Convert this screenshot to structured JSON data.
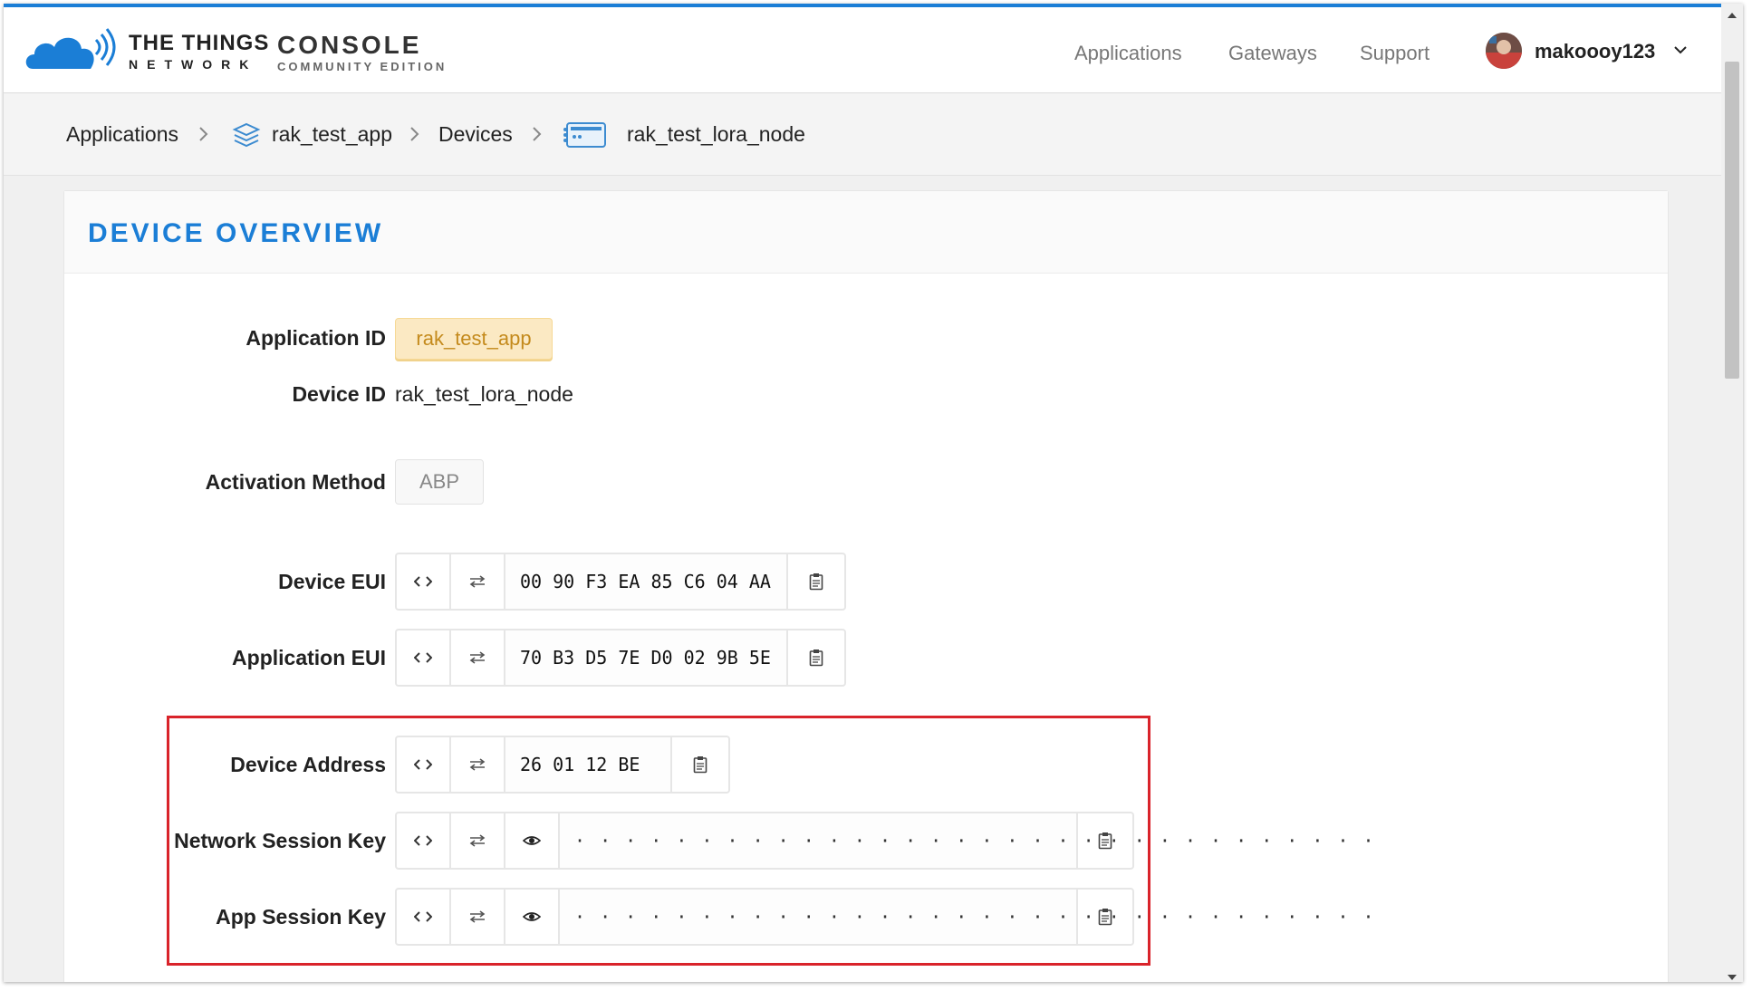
{
  "header": {
    "brand_top": "THE THINGS",
    "brand_bottom": "NETWORK",
    "console_top": "CONSOLE",
    "console_bottom": "COMMUNITY EDITION",
    "nav": [
      "Applications",
      "Gateways",
      "Support"
    ],
    "username": "makoooy123",
    "accent_color": "#1b7ed6"
  },
  "breadcrumbs": [
    {
      "label": "Applications",
      "icon": null
    },
    {
      "label": "rak_test_app",
      "icon": "application-stack-icon"
    },
    {
      "label": "Devices",
      "icon": null
    },
    {
      "label": "rak_test_lora_node",
      "icon": "device-board-icon"
    }
  ],
  "card": {
    "title": "DEVICE OVERVIEW",
    "application_id": {
      "label": "Application ID",
      "value": "rak_test_app"
    },
    "device_id": {
      "label": "Device ID",
      "value": "rak_test_lora_node"
    },
    "activation_method": {
      "label": "Activation Method",
      "value": "ABP"
    },
    "device_eui": {
      "label": "Device EUI",
      "value": "00 90 F3 EA 85 C6 04 AA"
    },
    "application_eui": {
      "label": "Application EUI",
      "value": "70 B3 D5 7E D0 02 9B 5E"
    },
    "device_address": {
      "label": "Device Address",
      "value": "26 01 12 BE"
    },
    "network_session_key": {
      "label": "Network Session Key",
      "value": "· · · · · · · · · · · · · · · · · · · · · · · · · · · · · · · ·"
    },
    "app_session_key": {
      "label": "App Session Key",
      "value": "· · · · · · · · · · · · · · · · · · · · · · · · · · · · · · · ·"
    }
  },
  "annotation": {
    "highlight_color": "#d9232a"
  }
}
